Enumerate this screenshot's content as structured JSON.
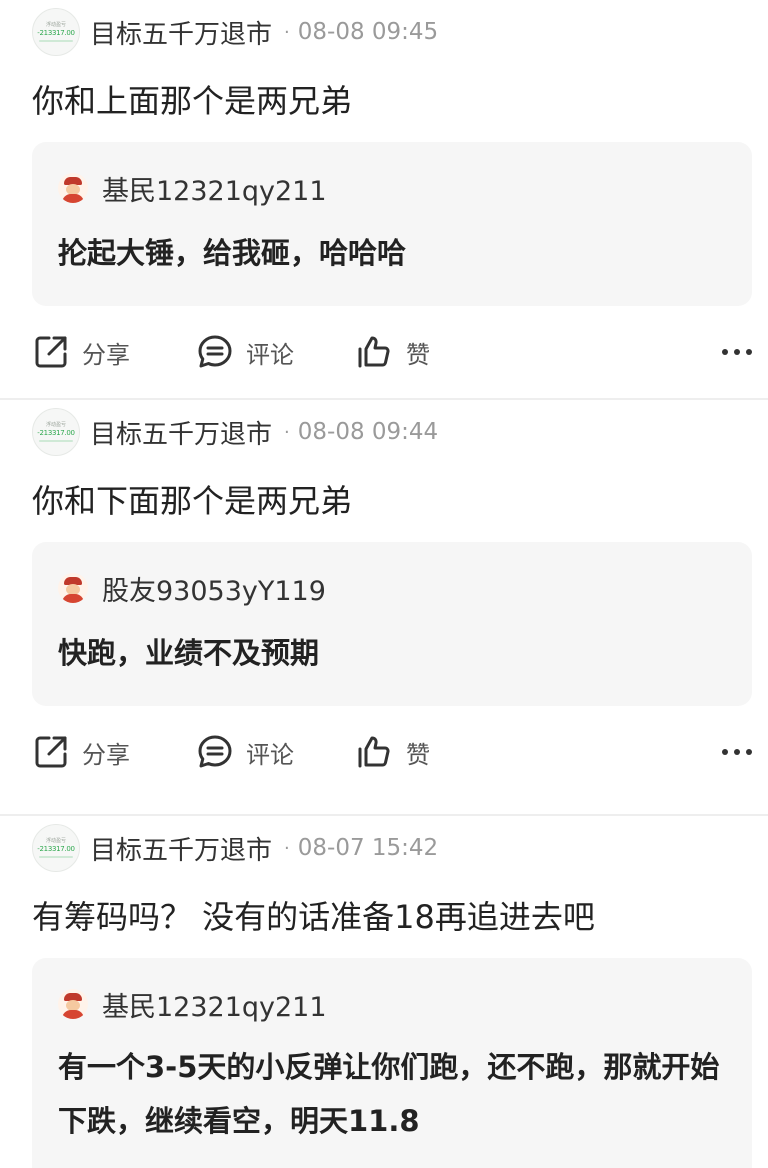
{
  "actions": {
    "share_label": "分享",
    "comment_label": "评论",
    "like_label": "赞"
  },
  "posts": [
    {
      "author": "目标五千万退市",
      "avatar_top": "浮动盈亏",
      "avatar_num": "-213317.00",
      "time": "08-08 09:45",
      "text": "你和上面那个是两兄弟",
      "quote": {
        "user": "基民12321qy211",
        "text": "抡起大锤，给我砸，哈哈哈"
      }
    },
    {
      "author": "目标五千万退市",
      "avatar_top": "浮动盈亏",
      "avatar_num": "-213317.00",
      "time": "08-08 09:44",
      "text": "你和下面那个是两兄弟",
      "quote": {
        "user": "股友93053yY119",
        "text": "快跑，业绩不及预期"
      }
    },
    {
      "author": "目标五千万退市",
      "avatar_top": "浮动盈亏",
      "avatar_num": "-213317.00",
      "time": "08-07 15:42",
      "text": "有筹码吗？ 没有的话准备18再追进去吧",
      "quote": {
        "user": "基民12321qy211",
        "text": "有一个3-5天的小反弹让你们跑，还不跑，那就开始下跌，继续看空，明天11.8"
      }
    }
  ]
}
